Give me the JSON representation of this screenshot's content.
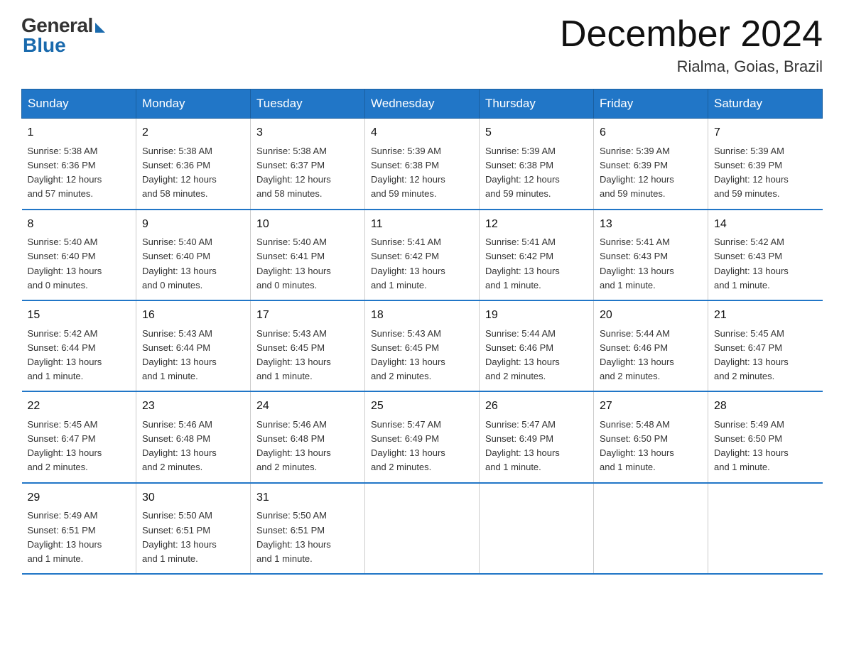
{
  "header": {
    "logo_general": "General",
    "logo_blue": "Blue",
    "month_title": "December 2024",
    "location": "Rialma, Goias, Brazil"
  },
  "days_of_week": [
    "Sunday",
    "Monday",
    "Tuesday",
    "Wednesday",
    "Thursday",
    "Friday",
    "Saturday"
  ],
  "weeks": [
    [
      {
        "day": "1",
        "sunrise": "5:38 AM",
        "sunset": "6:36 PM",
        "daylight": "12 hours and 57 minutes."
      },
      {
        "day": "2",
        "sunrise": "5:38 AM",
        "sunset": "6:36 PM",
        "daylight": "12 hours and 58 minutes."
      },
      {
        "day": "3",
        "sunrise": "5:38 AM",
        "sunset": "6:37 PM",
        "daylight": "12 hours and 58 minutes."
      },
      {
        "day": "4",
        "sunrise": "5:39 AM",
        "sunset": "6:38 PM",
        "daylight": "12 hours and 59 minutes."
      },
      {
        "day": "5",
        "sunrise": "5:39 AM",
        "sunset": "6:38 PM",
        "daylight": "12 hours and 59 minutes."
      },
      {
        "day": "6",
        "sunrise": "5:39 AM",
        "sunset": "6:39 PM",
        "daylight": "12 hours and 59 minutes."
      },
      {
        "day": "7",
        "sunrise": "5:39 AM",
        "sunset": "6:39 PM",
        "daylight": "12 hours and 59 minutes."
      }
    ],
    [
      {
        "day": "8",
        "sunrise": "5:40 AM",
        "sunset": "6:40 PM",
        "daylight": "13 hours and 0 minutes."
      },
      {
        "day": "9",
        "sunrise": "5:40 AM",
        "sunset": "6:40 PM",
        "daylight": "13 hours and 0 minutes."
      },
      {
        "day": "10",
        "sunrise": "5:40 AM",
        "sunset": "6:41 PM",
        "daylight": "13 hours and 0 minutes."
      },
      {
        "day": "11",
        "sunrise": "5:41 AM",
        "sunset": "6:42 PM",
        "daylight": "13 hours and 1 minute."
      },
      {
        "day": "12",
        "sunrise": "5:41 AM",
        "sunset": "6:42 PM",
        "daylight": "13 hours and 1 minute."
      },
      {
        "day": "13",
        "sunrise": "5:41 AM",
        "sunset": "6:43 PM",
        "daylight": "13 hours and 1 minute."
      },
      {
        "day": "14",
        "sunrise": "5:42 AM",
        "sunset": "6:43 PM",
        "daylight": "13 hours and 1 minute."
      }
    ],
    [
      {
        "day": "15",
        "sunrise": "5:42 AM",
        "sunset": "6:44 PM",
        "daylight": "13 hours and 1 minute."
      },
      {
        "day": "16",
        "sunrise": "5:43 AM",
        "sunset": "6:44 PM",
        "daylight": "13 hours and 1 minute."
      },
      {
        "day": "17",
        "sunrise": "5:43 AM",
        "sunset": "6:45 PM",
        "daylight": "13 hours and 1 minute."
      },
      {
        "day": "18",
        "sunrise": "5:43 AM",
        "sunset": "6:45 PM",
        "daylight": "13 hours and 2 minutes."
      },
      {
        "day": "19",
        "sunrise": "5:44 AM",
        "sunset": "6:46 PM",
        "daylight": "13 hours and 2 minutes."
      },
      {
        "day": "20",
        "sunrise": "5:44 AM",
        "sunset": "6:46 PM",
        "daylight": "13 hours and 2 minutes."
      },
      {
        "day": "21",
        "sunrise": "5:45 AM",
        "sunset": "6:47 PM",
        "daylight": "13 hours and 2 minutes."
      }
    ],
    [
      {
        "day": "22",
        "sunrise": "5:45 AM",
        "sunset": "6:47 PM",
        "daylight": "13 hours and 2 minutes."
      },
      {
        "day": "23",
        "sunrise": "5:46 AM",
        "sunset": "6:48 PM",
        "daylight": "13 hours and 2 minutes."
      },
      {
        "day": "24",
        "sunrise": "5:46 AM",
        "sunset": "6:48 PM",
        "daylight": "13 hours and 2 minutes."
      },
      {
        "day": "25",
        "sunrise": "5:47 AM",
        "sunset": "6:49 PM",
        "daylight": "13 hours and 2 minutes."
      },
      {
        "day": "26",
        "sunrise": "5:47 AM",
        "sunset": "6:49 PM",
        "daylight": "13 hours and 1 minute."
      },
      {
        "day": "27",
        "sunrise": "5:48 AM",
        "sunset": "6:50 PM",
        "daylight": "13 hours and 1 minute."
      },
      {
        "day": "28",
        "sunrise": "5:49 AM",
        "sunset": "6:50 PM",
        "daylight": "13 hours and 1 minute."
      }
    ],
    [
      {
        "day": "29",
        "sunrise": "5:49 AM",
        "sunset": "6:51 PM",
        "daylight": "13 hours and 1 minute."
      },
      {
        "day": "30",
        "sunrise": "5:50 AM",
        "sunset": "6:51 PM",
        "daylight": "13 hours and 1 minute."
      },
      {
        "day": "31",
        "sunrise": "5:50 AM",
        "sunset": "6:51 PM",
        "daylight": "13 hours and 1 minute."
      },
      null,
      null,
      null,
      null
    ]
  ],
  "labels": {
    "sunrise": "Sunrise:",
    "sunset": "Sunset:",
    "daylight": "Daylight:"
  }
}
